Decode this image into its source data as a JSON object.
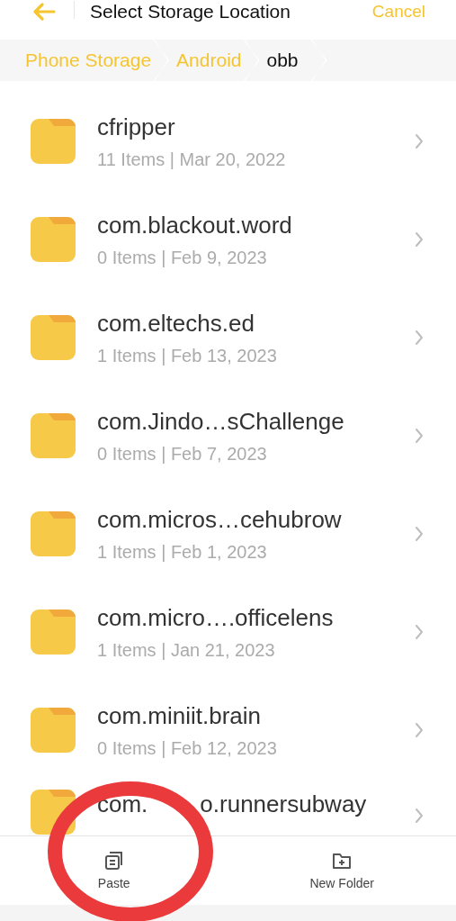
{
  "header": {
    "title": "Select Storage Location",
    "cancel": "Cancel"
  },
  "breadcrumbs": [
    {
      "label": "Phone Storage",
      "selected": false
    },
    {
      "label": "Android",
      "selected": false
    },
    {
      "label": "obb",
      "selected": true
    }
  ],
  "folders": [
    {
      "name": "cfripper",
      "meta": "11 Items | Mar 20, 2022"
    },
    {
      "name": "com.blackout.word",
      "meta": "0 Items | Feb 9, 2023"
    },
    {
      "name": "com.eltechs.ed",
      "meta": "1 Items | Feb 13, 2023"
    },
    {
      "name": "com.Jindo…sChallenge",
      "meta": "0 Items | Feb 7, 2023"
    },
    {
      "name": "com.micros…cehubrow",
      "meta": "1 Items | Feb 1, 2023"
    },
    {
      "name": "com.micro….officelens",
      "meta": "1 Items | Jan 21, 2023"
    },
    {
      "name": "com.miniit.brain",
      "meta": "0 Items | Feb 12, 2023"
    },
    {
      "name": "com.",
      "name_end": "o.runnersubway"
    }
  ],
  "actions": [
    {
      "kind": "paste",
      "label": "Paste"
    },
    {
      "kind": "new_folder",
      "label": "New Folder"
    }
  ]
}
